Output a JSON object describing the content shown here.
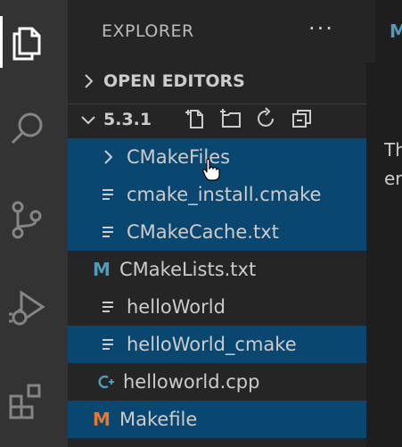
{
  "sidebar": {
    "title": "EXPLORER",
    "more_actions": "···",
    "open_editors": "OPEN EDITORS",
    "folder_name": "5.3.1",
    "items": [
      {
        "label": "CMakeFiles",
        "icon": "chevron-right-icon",
        "selected": true
      },
      {
        "label": "cmake_install.cmake",
        "icon": "file-lines-icon",
        "selected": true
      },
      {
        "label": "CMakeCache.txt",
        "icon": "file-lines-icon",
        "selected": true
      },
      {
        "label": "CMakeLists.txt",
        "icon": "m-icon",
        "selected": false
      },
      {
        "label": "helloWorld",
        "icon": "file-lines-icon",
        "selected": false
      },
      {
        "label": "helloWorld_cmake",
        "icon": "file-lines-icon",
        "selected": true
      },
      {
        "label": "helloworld.cpp",
        "icon": "cpp-icon",
        "selected": false
      },
      {
        "label": "Makefile",
        "icon": "makefile-icon",
        "selected": true
      }
    ]
  },
  "editor": {
    "tab_glyph": "M",
    "text_line1": "Th",
    "text_line2": "er"
  },
  "colors": {
    "selection": "#094771",
    "cmake_m": "#519aba",
    "makefile_m": "#e37933",
    "cpp": "#519aba"
  }
}
